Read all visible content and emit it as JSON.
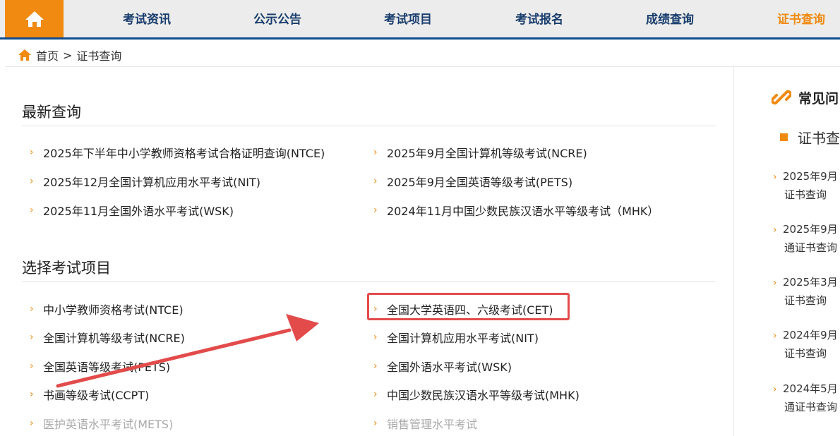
{
  "nav": {
    "home_icon": "home-icon",
    "items": [
      "考试资讯",
      "公示公告",
      "考试项目",
      "考试报名",
      "成绩查询",
      "证书查询"
    ]
  },
  "breadcrumb": {
    "home": "首页",
    "sep": ">",
    "current": "证书查询"
  },
  "latest": {
    "title": "最新查询",
    "left": [
      "2025年下半年中小学教师资格考试合格证明查询(NTCE)",
      "2025年12月全国计算机应用水平考试(NIT)",
      "2025年11月全国外语水平考试(WSK)"
    ],
    "right": [
      "2025年9月全国计算机等级考试(NCRE)",
      "2025年9月全国英语等级考试(PETS)",
      "2024年11月中国少数民族汉语水平等级考试（MHK）"
    ]
  },
  "exams": {
    "title": "选择考试项目",
    "left": [
      "中小学教师资格考试(NTCE)",
      "全国计算机等级考试(NCRE)",
      "全国英语等级考试(PETS)",
      "书画等级考试(CCPT)",
      "医护英语水平考试(METS)"
    ],
    "right": [
      "全国大学英语四、六级考试(CET)",
      "全国计算机应用水平考试(NIT)",
      "全国外语水平考试(WSK)",
      "中国少数民族汉语水平等级考试(MHK)",
      "销售管理水平考试"
    ]
  },
  "sidebar": {
    "title": "常见问",
    "sub": "证书查",
    "items": [
      [
        "2025年9月",
        "证书查询"
      ],
      [
        "2025年9月",
        "通证书查询"
      ],
      [
        "2025年3月",
        "证书查询"
      ],
      [
        "2024年9月",
        "证书查询"
      ],
      [
        "2024年5月",
        "通证书查询"
      ]
    ]
  },
  "colors": {
    "accent": "#f08a10",
    "nav_text": "#1a3e6e",
    "nav_border": "#0e4d8f",
    "highlight": "#e34b4b"
  }
}
